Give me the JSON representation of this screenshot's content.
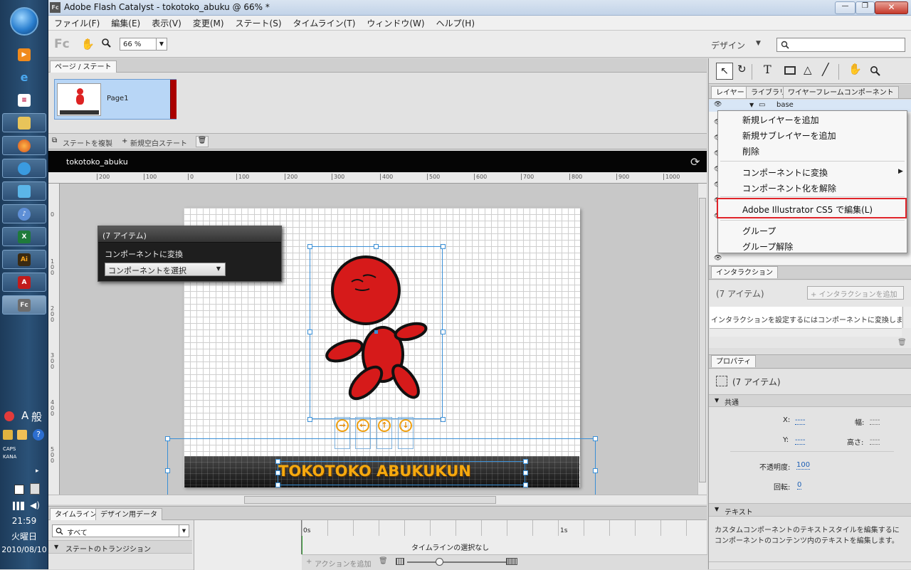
{
  "window": {
    "title": "Adobe Flash Catalyst - tokotoko_abuku @ 66% *",
    "app_icon": "Fc"
  },
  "menu": [
    "ファイル(F)",
    "編集(E)",
    "表示(V)",
    "変更(M)",
    "ステート(S)",
    "タイムライン(T)",
    "ウィンドウ(W)",
    "ヘルプ(H)"
  ],
  "toolbar": {
    "logo": "Fc",
    "zoom": "66 %",
    "workspace": "デザイン",
    "search_placeholder": ""
  },
  "pages": {
    "tab": "ページ / ステート",
    "page1": "Page1",
    "duplicate": "ステートを複製",
    "new_blank": "新規空白ステート"
  },
  "canvas": {
    "doc_title": "tokotoko_abuku",
    "ruler_h": [
      "200",
      "100",
      "0",
      "100",
      "200",
      "300",
      "400",
      "500",
      "600",
      "700",
      "800",
      "900",
      "1000"
    ],
    "ruler_v": [
      "0",
      "100",
      "200",
      "300",
      "400",
      "500"
    ]
  },
  "hud": {
    "title": "(7 アイテム)",
    "label": "コンポーネントに変換",
    "select": "コンポーネントを選択"
  },
  "banner": {
    "text": "TOKOTOKO ABUKUKUN"
  },
  "tools": {
    "tabs": [
      "レイヤー",
      "ライブラリ",
      "ワイヤーフレームコンポーネント"
    ],
    "layer_name": "base"
  },
  "context_menu": {
    "items": [
      "新規レイヤーを追加",
      "新規サブレイヤーを追加",
      "削除",
      "コンポーネントに変換",
      "コンポーネント化を解除",
      "Adobe Illustrator CS5 で編集(L)",
      "グループ",
      "グループ解除"
    ]
  },
  "interactions": {
    "tab": "インタラクション",
    "title": "(7 アイテム)",
    "add_button": "インタラクションを追加",
    "hint": "インタラクションを設定するにはコンポーネントに変換しま"
  },
  "properties": {
    "tab": "プロパティ",
    "title": "(7 アイテム)",
    "common": "共通",
    "x_label": "X:",
    "x_value": "----",
    "w_label": "幅:",
    "w_value": "----",
    "y_label": "Y:",
    "y_value": "----",
    "h_label": "高さ:",
    "h_value": "----",
    "opacity_label": "不透明度:",
    "opacity_value": "100",
    "rotation_label": "回転:",
    "rotation_value": "0",
    "text_section": "テキスト",
    "text_desc_1": "カスタムコンポーネントのテキストスタイルを編集するに",
    "text_desc_2": "コンポーネントのコンテンツ内のテキストを編集します。"
  },
  "timeline": {
    "tabs": [
      "タイムライン",
      "デザイン用データ"
    ],
    "filter": "すべて",
    "row": "ステートのトランジション",
    "t0": "0s",
    "t1": "1s",
    "empty": "タイムラインの選択なし",
    "add_action": "アクションを追加"
  },
  "system": {
    "ime_a": "A",
    "ime_mode": "般",
    "caps": "CAPS",
    "kana": "KANA",
    "time": "21:59",
    "day": "火曜日",
    "date": "2010/08/10"
  }
}
